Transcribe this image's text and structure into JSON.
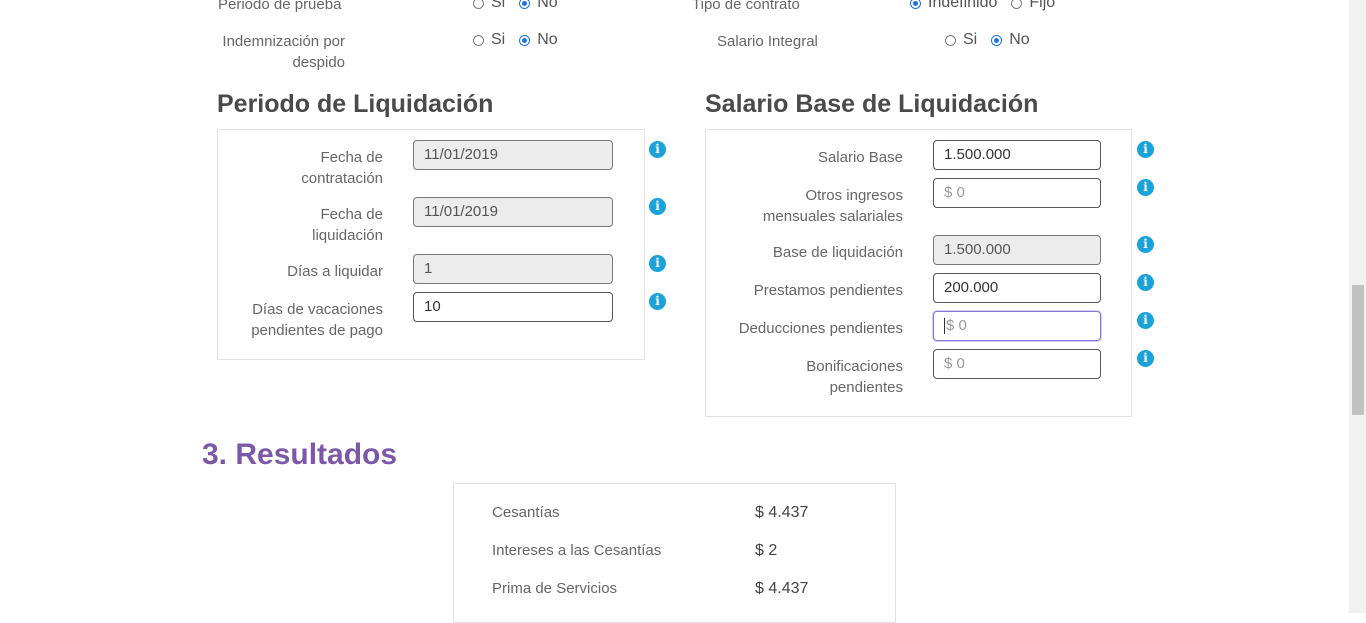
{
  "top_options": {
    "periodo_prueba": {
      "label": "Periodo de prueba",
      "options": [
        "Si",
        "No"
      ],
      "selected": "No"
    },
    "indemnizacion": {
      "label_line1": "Indemnización por",
      "label_line2": "despido",
      "options": [
        "Si",
        "No"
      ],
      "selected": "No"
    },
    "tipo_contrato": {
      "label": "Tipo de contrato",
      "options": [
        "Indefinido",
        "Fijo"
      ],
      "selected": "Indefinido"
    },
    "salario_integral": {
      "label": "Salario Integral",
      "options": [
        "Si",
        "No"
      ],
      "selected": "No"
    }
  },
  "periodo": {
    "title": "Periodo de Liquidación",
    "fields": [
      {
        "label_line1": "Fecha de",
        "label_line2": "contratación",
        "value": "11/01/2019"
      },
      {
        "label_line1": "Fecha de",
        "label_line2": "liquidación",
        "value": "11/01/2019"
      },
      {
        "label_line1": "Días a liquidar",
        "label_line2": "",
        "value": "1"
      },
      {
        "label_line1": "Días de vacaciones",
        "label_line2": "pendientes de pago",
        "value": "10"
      }
    ]
  },
  "salario": {
    "title": "Salario Base de Liquidación",
    "fields": [
      {
        "label_line1": "Salario Base",
        "label_line2": "",
        "value": "1.500.000"
      },
      {
        "label_line1": "Otros ingresos",
        "label_line2": "mensuales salariales",
        "placeholder": "$ 0"
      },
      {
        "label_line1": "Base de liquidación",
        "label_line2": "",
        "value": "1.500.000"
      },
      {
        "label_line1": "Prestamos pendientes",
        "label_line2": "",
        "value": "200.000"
      },
      {
        "label_line1": "Deducciones pendientes",
        "label_line2": "",
        "placeholder": "$ 0"
      },
      {
        "label_line1": "Bonificaciones",
        "label_line2": "pendientes",
        "placeholder": "$ 0"
      }
    ]
  },
  "resultados": {
    "title": "3. Resultados",
    "rows": [
      {
        "label": "Cesantías",
        "value": "$ 4.437"
      },
      {
        "label": "Intereses a las Cesantías",
        "value": "$ 2"
      },
      {
        "label": "Prima de Servicios",
        "value": "$ 4.437"
      }
    ]
  },
  "icons": {
    "info": "info-icon"
  },
  "colors": {
    "accent_purple": "#7b59a8",
    "info_blue": "#1aa3d9",
    "radio_blue": "#1a73e8"
  }
}
